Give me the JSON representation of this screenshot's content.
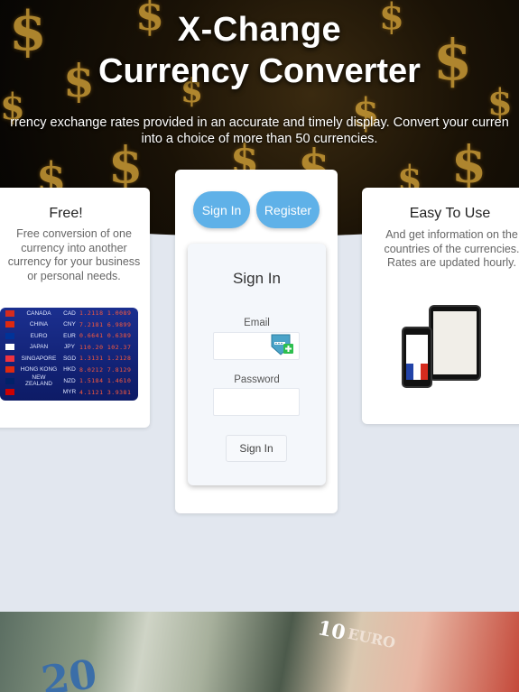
{
  "hero": {
    "title_line1": "X-Change",
    "title_line2": "Currency Converter",
    "desc_line1": "rrency exchange rates provided in an accurate and timely display. Convert your curren",
    "desc_line2": "into a choice of more than 50 currencies."
  },
  "left_card": {
    "title": "Free!",
    "text": "Free conversion of one currency into another currency for your business or personal needs.",
    "board_rows": [
      {
        "name": "CANADA",
        "code": "CAD",
        "digits": "1.2118 1.0089"
      },
      {
        "name": "CHINA",
        "code": "CNY",
        "digits": "7.2181 6.9899"
      },
      {
        "name": "EURO",
        "code": "EUR",
        "digits": "0.6641 0.6389"
      },
      {
        "name": "JAPAN",
        "code": "JPY",
        "digits": "110.20 102.37"
      },
      {
        "name": "SINGAPORE",
        "code": "SGD",
        "digits": "1.3131 1.2128"
      },
      {
        "name": "HONG KONG",
        "code": "HKD",
        "digits": "8.0212 7.8129"
      },
      {
        "name": "NEW ZEALAND",
        "code": "NZD",
        "digits": "1.5184 1.4610"
      },
      {
        "name": "",
        "code": "MYR",
        "digits": "4.1121 3.9381"
      }
    ]
  },
  "right_card": {
    "title": "Easy To Use",
    "text": "And get information on the countries of the currencies. Rates are updated hourly."
  },
  "auth": {
    "signin_pill": "Sign In",
    "register_pill": "Register",
    "form_title": "Sign In",
    "email_label": "Email",
    "password_label": "Password",
    "submit_label": "Sign In"
  },
  "notes": {
    "twenty": "20",
    "ten": "10",
    "euro": "EURO"
  },
  "colors": {
    "accent": "#5fb1e8",
    "background": "#e2e7ef"
  }
}
